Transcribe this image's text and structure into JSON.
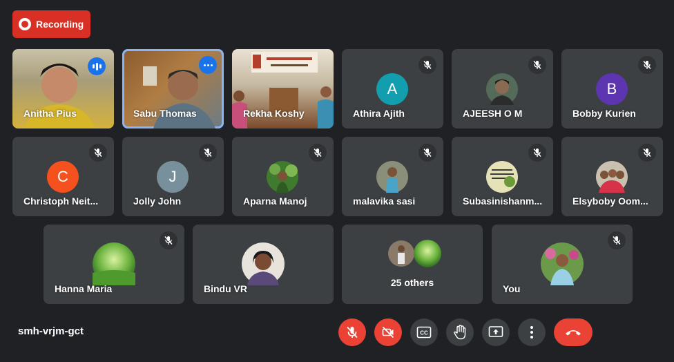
{
  "recording": {
    "label": "Recording"
  },
  "meeting": {
    "code": "smh-vrjm-gct"
  },
  "participants_row1": [
    {
      "name": "Anitha Pius"
    },
    {
      "name": "Sabu Thomas"
    },
    {
      "name": "Rekha Koshy"
    },
    {
      "name": "Athira Ajith",
      "initial": "A",
      "color": "#129eaf"
    },
    {
      "name": "AJEESH O M"
    },
    {
      "name": "Bobby Kurien",
      "initial": "B",
      "color": "#5e35b1"
    }
  ],
  "participants_row2": [
    {
      "name": "Christoph Neit...",
      "initial": "C",
      "color": "#f4511e"
    },
    {
      "name": "Jolly John",
      "initial": "J",
      "color": "#78909c"
    },
    {
      "name": "Aparna Manoj"
    },
    {
      "name": "malavika sasi"
    },
    {
      "name": "Subasinishanm..."
    },
    {
      "name": "Elsyboby Oom..."
    }
  ],
  "participants_row3": [
    {
      "name": "Hanna Maria"
    },
    {
      "name": "Bindu VR"
    },
    {
      "name": "25 others"
    },
    {
      "name": "You"
    }
  ],
  "colors": {
    "background": "#202124",
    "tile": "#3c4043",
    "accent": "#8ab4f8",
    "danger": "#ea4335"
  },
  "icons": {
    "mic_off": "mic-off-icon",
    "camera_off": "camera-off-icon",
    "captions": "captions-icon",
    "raise_hand": "hand-icon",
    "present": "present-icon",
    "more": "more-vert-icon",
    "end_call": "end-call-icon"
  }
}
